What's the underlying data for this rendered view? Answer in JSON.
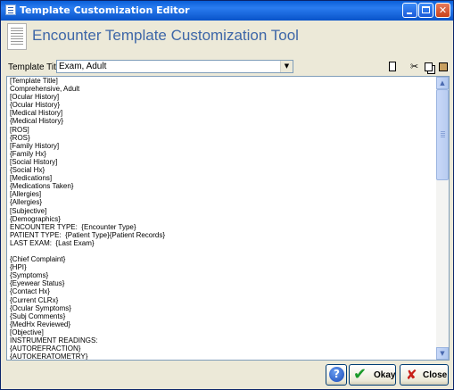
{
  "window": {
    "title": "Template Customization Editor"
  },
  "header": {
    "app_title": "Encounter Template Customization Tool"
  },
  "template_title": {
    "label": "Template Title:",
    "selected": "Exam, Adult"
  },
  "editor_lines": [
    "[Template Title]",
    "Comprehensive, Adult",
    "[Ocular History]",
    "{Ocular History}",
    "[Medical History]",
    "{Medical History}",
    "[ROS]",
    "{ROS}",
    "[Family History]",
    "{Family Hx}",
    "[Social History]",
    "{Social Hx}",
    "[Medications]",
    "{Medications Taken}",
    "[Allergies]",
    "{Allergies}",
    "[Subjective]",
    "{Demographics}",
    "ENCOUNTER TYPE:  {Encounter Type}",
    "PATIENT TYPE:  {Patient Type}{Patient Records}",
    "LAST EXAM:  {Last Exam}",
    "",
    "{Chief Complaint}",
    "{HPI}",
    "{Symptoms}",
    "{Eyewear Status}",
    "{Contact Hx}",
    "{Current CLRx}",
    "{Ocular Symptoms}",
    "{Subj Comments}",
    "{MedHx Reviewed}",
    "[Objective]",
    "INSTRUMENT READINGS:",
    "{AUTOREFRACTION}",
    "{AUTOKERATOMETRY}"
  ],
  "buttons": {
    "help": "?",
    "okay": "Okay",
    "close": "Close"
  }
}
